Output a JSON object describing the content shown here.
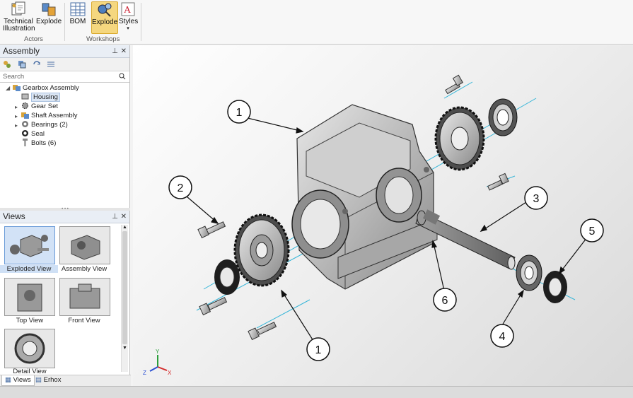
{
  "ribbon": {
    "buttons": [
      {
        "label": "Technical\nIllustration",
        "icon": "technical-illustration-icon"
      },
      {
        "label": "Explode",
        "icon": "explode-icon"
      },
      {
        "label": "BOM",
        "icon": "bom-table-icon"
      },
      {
        "label": "Explode",
        "icon": "explode-workshop-icon",
        "active": true
      },
      {
        "label": "Styles",
        "icon": "styles-icon"
      }
    ],
    "groups": [
      "Actors",
      "Workshops"
    ]
  },
  "assembly_panel": {
    "title": "Assembly",
    "search_placeholder": "Search",
    "tree": {
      "root": "Gearbox Assembly",
      "items": [
        "Housing",
        "Gear Set",
        "Shaft Assembly",
        "Bearings (2)",
        "Seal",
        "Bolts (6)"
      ],
      "selected": "Housing"
    }
  },
  "views_panel": {
    "title": "Views",
    "views": [
      "Exploded View",
      "Assembly View",
      "Top View",
      "Front View",
      "Detail View"
    ],
    "selected": "Exploded View"
  },
  "bottom_tabs": [
    "Views",
    "Erhox"
  ],
  "viewport": {
    "callouts": [
      "1",
      "2",
      "3",
      "1",
      "4",
      "5",
      "6"
    ],
    "axis_labels": [
      "Y",
      "X",
      "Z"
    ]
  },
  "colors": {
    "accent": "#f5d77f",
    "selection": "#cfe0f5",
    "centerline": "#34b5d8"
  }
}
